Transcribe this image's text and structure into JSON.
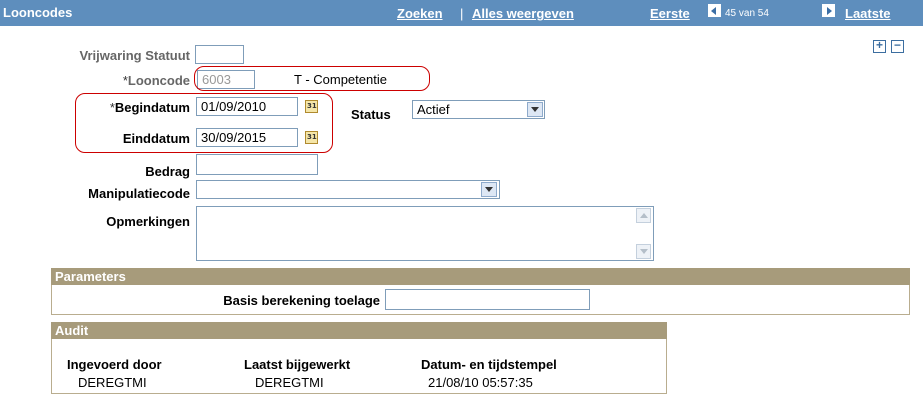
{
  "header": {
    "title": "Looncodes",
    "find_link": "Zoeken",
    "separator": "|",
    "view_all_link": "Alles weergeven",
    "first_link": "Eerste",
    "record_position": "45 van 54",
    "last_link": "Laatste"
  },
  "form": {
    "vrijwaring_statuut": {
      "label": "Vrijwaring Statuut",
      "value": ""
    },
    "looncode": {
      "required_marker": "*",
      "label": "Looncode",
      "value": "6003",
      "description": "T - Competentie"
    },
    "begindatum": {
      "required_marker": "*",
      "label": "Begindatum",
      "value": "01/09/2010"
    },
    "einddatum": {
      "label": "Einddatum",
      "value": "30/09/2015"
    },
    "status": {
      "label": "Status",
      "value": "Actief"
    },
    "bedrag": {
      "label": "Bedrag",
      "value": ""
    },
    "manipulatiecode": {
      "label": "Manipulatiecode",
      "value": ""
    },
    "opmerkingen": {
      "label": "Opmerkingen",
      "value": ""
    }
  },
  "row_controls": {
    "add": "+",
    "remove": "−"
  },
  "parameters": {
    "title": "Parameters",
    "basis_label": "Basis berekening toelage",
    "basis_value": ""
  },
  "audit": {
    "title": "Audit",
    "columns": [
      "Ingevoerd door",
      "Laatst bijgewerkt",
      "Datum- en tijdstempel"
    ],
    "values": [
      "DEREGTMI",
      "DEREGTMI",
      "21/08/10 05:57:35"
    ]
  },
  "colors": {
    "header_bg": "#5e8ebd",
    "group_header_bg": "#a79b7b",
    "highlight_border": "#cc0000"
  }
}
